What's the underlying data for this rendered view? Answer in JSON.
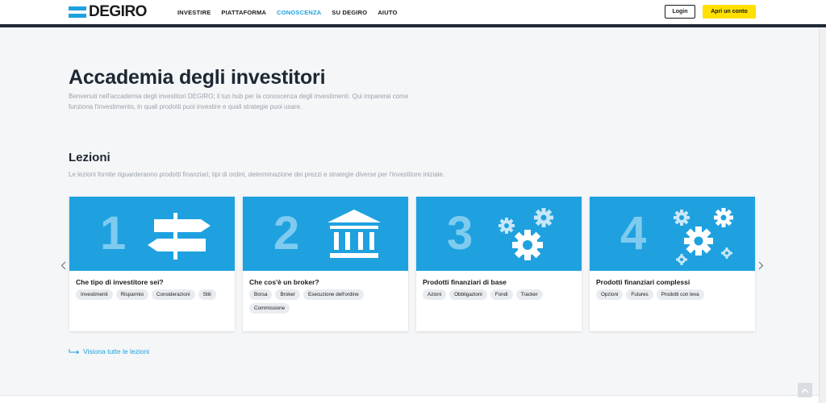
{
  "header": {
    "logo_text": "DEGIRO",
    "nav": [
      {
        "label": "INVESTIRE"
      },
      {
        "label": "PIATTAFORMA"
      },
      {
        "label": "CONOSCENZA",
        "active": true
      },
      {
        "label": "SU DEGIRO"
      },
      {
        "label": "AIUTO"
      }
    ],
    "login_label": "Login",
    "open_account_label": "Apri un conto"
  },
  "main": {
    "title": "Accademia degli investitori",
    "intro": "Benvenuti nell'accademia degli investitori DEGIRO; il tuo hub per la conoscenza degli investimenti. Qui imparerai come funziona l'investimento, in quali prodotti puoi investire e quali strategie puoi usare.",
    "lessons_title": "Lezioni",
    "lessons_desc": "Le lezioni fornite riguarderanno prodotti finanziari, tipi di ordini, determinazione dei prezzi e strategie diverse per l'investitore iniziale.",
    "view_all_label": "Visiona tutte le lezioni"
  },
  "cards": [
    {
      "number": "1",
      "icon": "signpost-icon",
      "title": "Che tipo di investitore sei?",
      "tags": [
        "Investimenti",
        "Risparmio",
        "Considerazioni",
        "Stili"
      ]
    },
    {
      "number": "2",
      "icon": "bank-icon",
      "title": "Che cos'è un broker?",
      "tags": [
        "Borsa",
        "Broker",
        "Esecuzione dell'ordine",
        "Commissione"
      ]
    },
    {
      "number": "3",
      "icon": "gears-icon",
      "title": "Prodotti finanziari di base",
      "tags": [
        "Azioni",
        "Obbligazioni",
        "Fondi",
        "Tracker"
      ]
    },
    {
      "number": "4",
      "icon": "gears-icon",
      "title": "Prodotti finanziari complessi",
      "tags": [
        "Opzioni",
        "Futures",
        "Prodotti con leva"
      ]
    }
  ],
  "colors": {
    "accent": "#1fa1e0",
    "cta": "#ffe000",
    "dark": "#1f2a36"
  }
}
